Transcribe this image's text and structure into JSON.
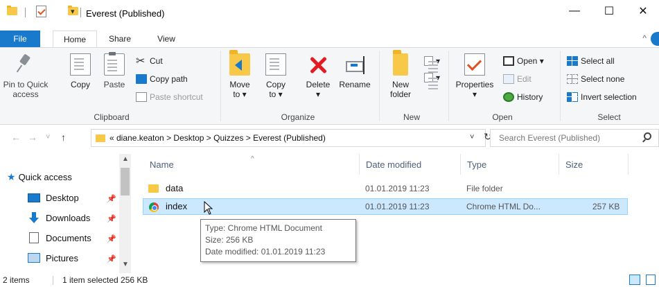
{
  "window": {
    "title": "Everest (Published)",
    "minimize_glyph": "—",
    "maximize_glyph": "☐",
    "close_glyph": "✕",
    "qa_dropdown_glyph": "▾"
  },
  "ribbon_tabs": [
    "File",
    "Home",
    "Share",
    "View"
  ],
  "ribbon_toggle_glyph": "^",
  "ribbon": {
    "clipboard": {
      "pin_label": "Pin to Quick access",
      "pin_line1": "Pin to Quick",
      "pin_line2": "access",
      "copy": "Copy",
      "paste": "Paste",
      "cut": "Cut",
      "copy_path": "Copy path",
      "paste_shortcut": "Paste shortcut",
      "group": "Clipboard"
    },
    "organize": {
      "move_to": "Move",
      "move_to2": "to ▾",
      "copy_to": "Copy",
      "copy_to2": "to ▾",
      "delete": "Delete",
      "delete2": "▾",
      "rename": "Rename",
      "group": "Organize"
    },
    "new": {
      "new_folder": "New",
      "new_folder2": "folder",
      "new_item_glyph": "▾",
      "easy_access_glyph": "▾",
      "group": "New"
    },
    "open": {
      "properties": "Properties",
      "properties2": "▾",
      "open": "Open ▾",
      "edit": "Edit",
      "history": "History",
      "group": "Open"
    },
    "select": {
      "select_all": "Select all",
      "select_none": "Select none",
      "invert_selection": "Invert selection",
      "group": "Select"
    }
  },
  "address": {
    "back": "←",
    "forward": "→",
    "recent": "˅",
    "up": "↑",
    "path": "« diane.keaton  >  Desktop  >  Quizzes  >  Everest (Published)",
    "dropdown": "˅",
    "refresh": "↻",
    "search_placeholder": "Search Everest (Published)"
  },
  "nav_pane": {
    "quick_access": "Quick access",
    "pin_glyph": "📌",
    "items": [
      {
        "label": "Desktop",
        "icon": "desktop-icon",
        "pinned": true
      },
      {
        "label": "Downloads",
        "icon": "downloads-icon",
        "pinned": true
      },
      {
        "label": "Documents",
        "icon": "documents-icon",
        "pinned": true
      },
      {
        "label": "Pictures",
        "icon": "pictures-icon",
        "pinned": true
      }
    ],
    "scroll_up": "▲",
    "scroll_down": "▼"
  },
  "file_list": {
    "sort_glyph": "^",
    "columns": [
      "Name",
      "Date modified",
      "Type",
      "Size"
    ],
    "rows": [
      {
        "name": "data",
        "date": "01.01.2019 11:23",
        "type": "File folder",
        "size": "",
        "icon": "folder-icon",
        "selected": false
      },
      {
        "name": "index",
        "date": "01.01.2019 11:23",
        "type": "Chrome HTML Do...",
        "size": "257 KB",
        "icon": "chrome-icon",
        "selected": true
      }
    ]
  },
  "tooltip": {
    "type_line": "Type: Chrome HTML Document",
    "size_line": "Size: 256 KB",
    "date_line": "Date modified: 01.01.2019 11:23"
  },
  "status_bar": {
    "item_count": "2 items",
    "selection": "1 item selected  256 KB"
  },
  "colors": {
    "accent": "#1979ca",
    "selection_bg": "#cce8ff",
    "delete_red": "#e31b23",
    "folder_yellow": "#f8c848"
  }
}
